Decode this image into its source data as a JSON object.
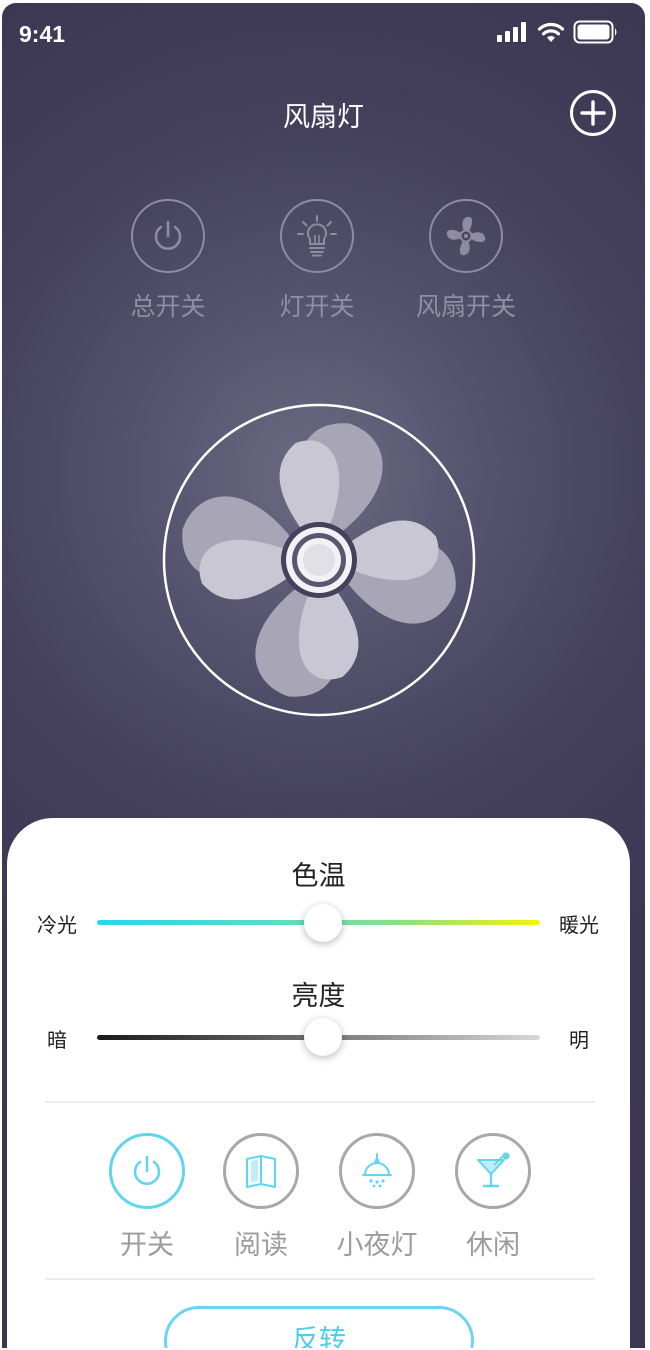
{
  "status_bar": {
    "time": "9:41",
    "icons": [
      "signal-icon",
      "wifi-icon",
      "battery-icon"
    ]
  },
  "header": {
    "title": "风扇灯",
    "add_icon": "add-icon"
  },
  "top_switches": [
    {
      "label": "总开关",
      "icon": "power-icon"
    },
    {
      "label": "灯开关",
      "icon": "bulb-icon"
    },
    {
      "label": "风扇开关",
      "icon": "fan-icon"
    }
  ],
  "color_temperature": {
    "title": "色温",
    "min_label": "冷光",
    "max_label": "暖光",
    "value": 0.51
  },
  "brightness": {
    "title": "亮度",
    "min_label": "暗",
    "max_label": "明",
    "value": 0.51
  },
  "modes": [
    {
      "label": "开关",
      "icon": "power-icon",
      "active": true
    },
    {
      "label": "阅读",
      "icon": "book-icon",
      "active": false
    },
    {
      "label": "小夜灯",
      "icon": "night-lamp-icon",
      "active": false
    },
    {
      "label": "休闲",
      "icon": "cocktail-icon",
      "active": false
    }
  ],
  "reverse_button": "反转",
  "colors": {
    "background": "#3b3652",
    "accent": "#5fd5f0",
    "panel": "#ffffff"
  }
}
